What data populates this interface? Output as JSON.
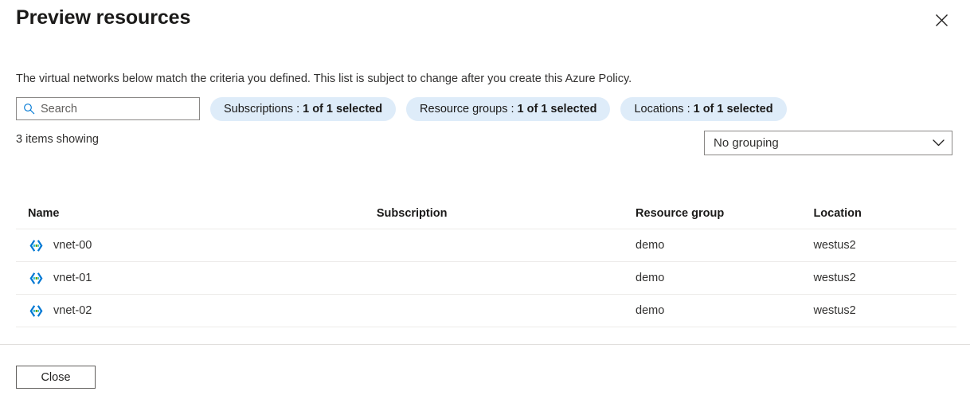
{
  "header": {
    "title": "Preview resources",
    "close_icon": "close-icon"
  },
  "description": "The virtual networks below match the criteria you defined. This list is subject to change after you create this Azure Policy.",
  "filters": {
    "search": {
      "icon": "search-icon",
      "placeholder": "Search",
      "value": ""
    },
    "pills": [
      {
        "label": "Subscriptions :",
        "value": "1 of 1 selected"
      },
      {
        "label": "Resource groups :",
        "value": "1 of 1 selected"
      },
      {
        "label": "Locations :",
        "value": "1 of 1 selected"
      }
    ]
  },
  "results": {
    "count_text": "3 items showing",
    "grouping": {
      "selected": "No grouping",
      "chevron_icon": "chevron-down-icon"
    }
  },
  "table": {
    "columns": [
      "Name",
      "Subscription",
      "Resource group",
      "Location"
    ],
    "rows": [
      {
        "icon": "virtual-network-icon",
        "name": "vnet-00",
        "subscription": "",
        "resource_group": "demo",
        "location": "westus2"
      },
      {
        "icon": "virtual-network-icon",
        "name": "vnet-01",
        "subscription": "",
        "resource_group": "demo",
        "location": "westus2"
      },
      {
        "icon": "virtual-network-icon",
        "name": "vnet-02",
        "subscription": "",
        "resource_group": "demo",
        "location": "westus2"
      }
    ]
  },
  "footer": {
    "close_label": "Close"
  },
  "colors": {
    "pill_background": "#deecf9",
    "accent_blue": "#0078d4",
    "icon_blue": "#0078d4",
    "icon_cyan": "#32bedd",
    "icon_green": "#5ea000",
    "border": "#8a8886",
    "row_divider": "#edebe9"
  }
}
